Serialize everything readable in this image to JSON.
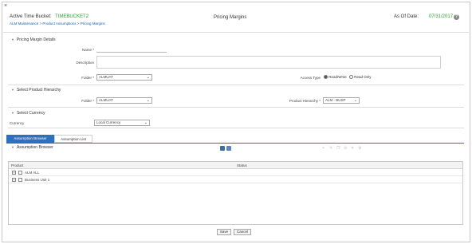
{
  "header": {
    "close_glyph": "×",
    "active_label": "Active Time Bucket:",
    "active_value": "TIMEBUCKET2",
    "breadcrumb": "ALM Maintenance > Product Assumptions > Pricing Margins",
    "title": "Pricing Margins",
    "as_of_label": "As Of Date:",
    "as_of_value": "07/31/2017",
    "help_glyph": "?"
  },
  "details": {
    "section_title": "Pricing Margin Details",
    "name_label": "Name *",
    "name_value": "",
    "description_label": "Description",
    "description_value": "",
    "folder_label": "Folder *",
    "folder_value": "ALMUAT",
    "access_label": "Access Type",
    "access_option_readonly": "Read/Write",
    "access_option_readwrite": "Read Only"
  },
  "hierarchy": {
    "section_title": "Select Product Hierarchy",
    "folder_label": "Folder *",
    "folder_value": "ALMUAT",
    "hierarchy_label": "Product Hierarchy *",
    "hierarchy_value": "ALM - BUSP"
  },
  "currency": {
    "section_title": "Select Currency",
    "currency_label": "Currency",
    "currency_value": "Local Currency"
  },
  "tabs": {
    "browser": "Assumption Browser",
    "list": "Assumption List"
  },
  "browser": {
    "section_title": "Assumption Browser",
    "col_product": "Product",
    "col_status": "Status",
    "rows": [
      {
        "label": "ALM ALL"
      },
      {
        "label": "Business Unit 1"
      }
    ]
  },
  "footer": {
    "save": "Save",
    "cancel": "Cancel"
  },
  "colors": {
    "accent": "#2f6fc0",
    "highlight_green": "#2e9f2e",
    "link_blue": "#1a5ea6"
  }
}
